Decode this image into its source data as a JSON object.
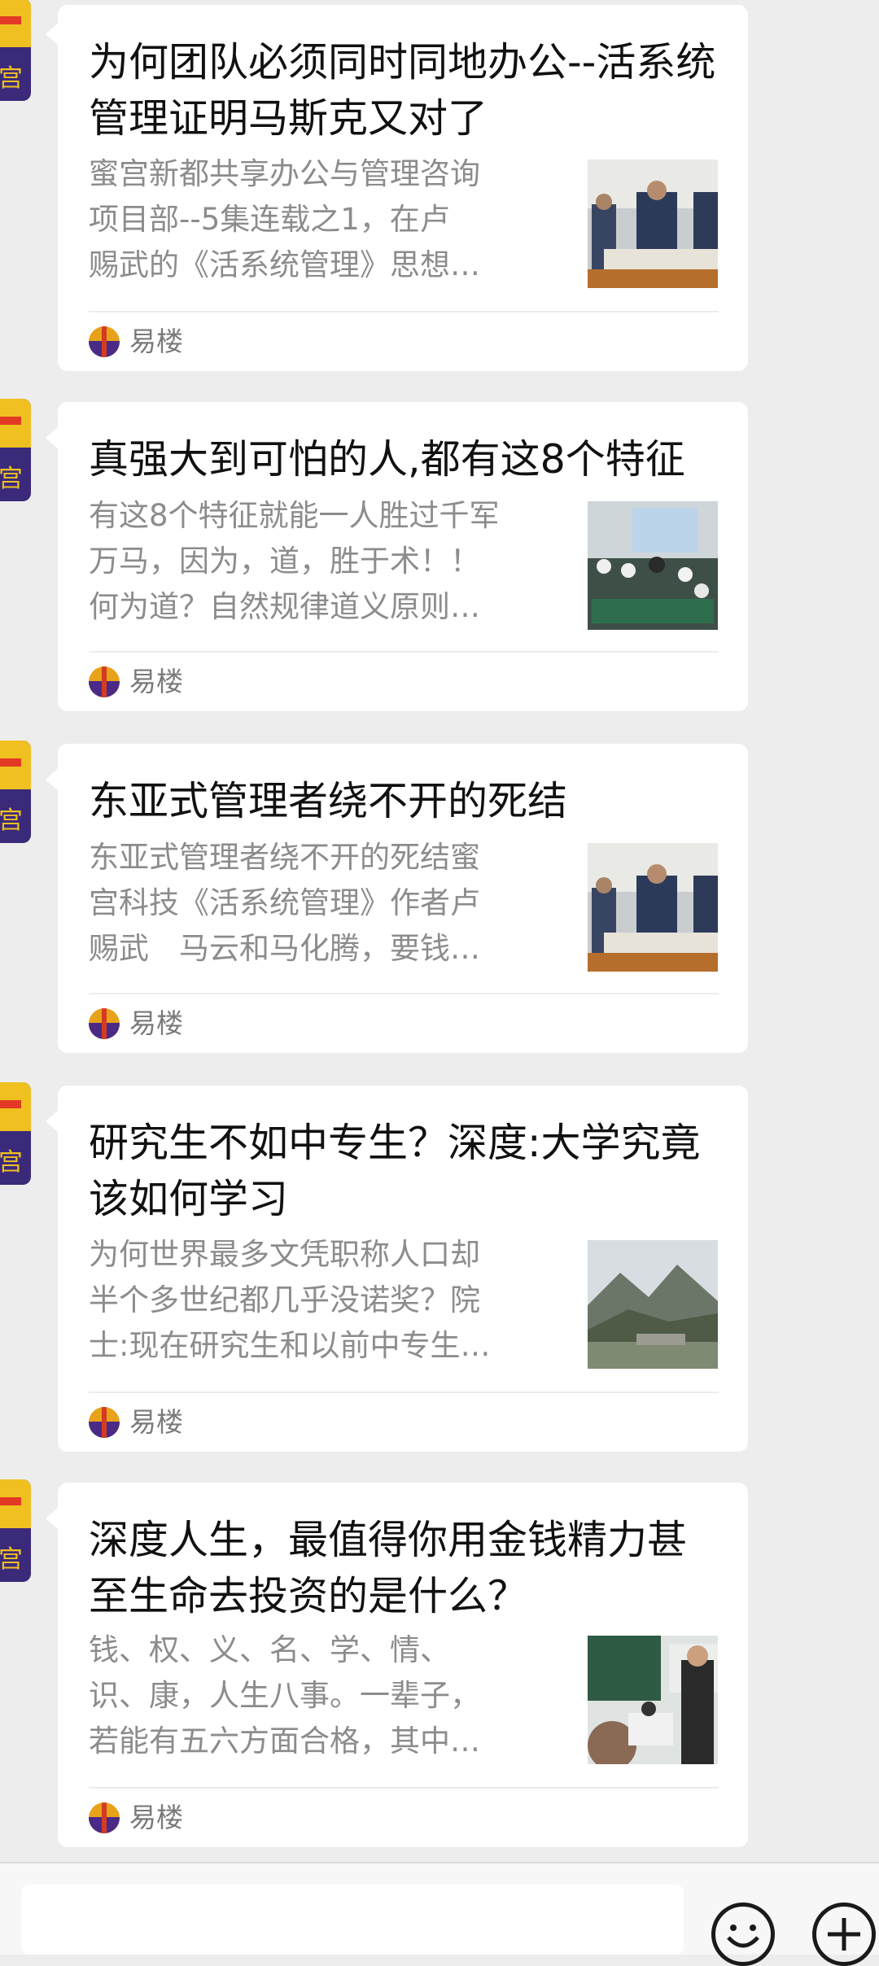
{
  "messages": [
    {
      "title": "为何团队必须同时同地办公--活系统管理证明马斯克又对了",
      "desc": [
        "蜜宫新都共享办公与管理咨询",
        "项目部--5集连载之1，在卢",
        "赐武的《活系统管理》思想…"
      ],
      "source": "易楼",
      "thumb": "meeting-photo"
    },
    {
      "title": "真强大到可怕的人,都有这8个特征",
      "desc": [
        "有这8个特征就能一人胜过千军",
        "万马，因为，道，胜于术！！",
        "何为道？自然规律道义原则…"
      ],
      "source": "易楼",
      "thumb": "lecture-hall-photo"
    },
    {
      "title": "东亚式管理者绕不开的死结",
      "desc": [
        "东亚式管理者绕不开的死结蜜",
        "宫科技《活系统管理》作者卢",
        "赐武　马云和马化腾，要钱…"
      ],
      "source": "易楼",
      "thumb": "meeting-photo"
    },
    {
      "title": "研究生不如中专生？深度:大学究竟该如何学习",
      "desc": [
        "为何世界最多文凭职称人口却",
        "半个多世纪都几乎没诺奖？院",
        "士:现在研究生和以前中专生…"
      ],
      "source": "易楼",
      "thumb": "mountain-photo"
    },
    {
      "title": "深度人生，最值得你用金钱精力甚至生命去投资的是什么？",
      "desc": [
        "钱、权、义、名、学、情、",
        "识、康，人生八事。一辈子，",
        "若能有五六方面合格，其中…"
      ],
      "source": "易楼",
      "thumb": "classroom-photo"
    }
  ],
  "avatar_char": "宫",
  "bottom_bar": {
    "input_placeholder": "",
    "icons": [
      "emoji-icon",
      "plus-icon"
    ]
  },
  "colors": {
    "background": "#ededed",
    "card": "#ffffff",
    "title": "#111111",
    "desc": "#8c8c8c",
    "source": "#7a7a7a"
  }
}
